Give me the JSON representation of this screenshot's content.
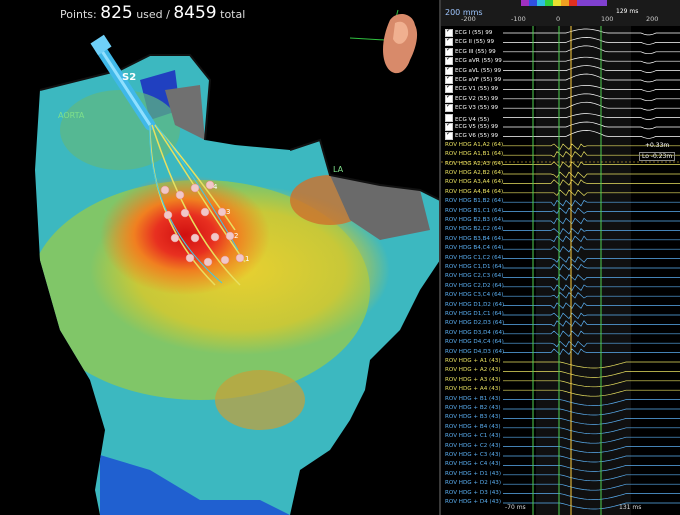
{
  "points": {
    "prefix": "Points:",
    "used": "825",
    "used_label": "used /",
    "total": "8459",
    "total_label": "total"
  },
  "labels": {
    "aorta": "AORTA",
    "la": "LA",
    "catheter": "S2"
  },
  "electrodes": [
    "4",
    "3",
    "2",
    "1",
    "4",
    "3",
    "2",
    "1"
  ],
  "ecg_panel": {
    "speed": "200 mms",
    "ticks": [
      "-200",
      "-100",
      "0",
      "100",
      "200"
    ],
    "measure_top": "129 ms",
    "measure_left": "-70 ms",
    "measure_right": "131 ms",
    "cursor_a": "+0.33m",
    "cursor_b": "Lo -0.23m"
  },
  "leads": [
    {
      "label": "ECG I (55) 99",
      "color": "#ffffff",
      "checked": true
    },
    {
      "label": "ECG II (55) 99",
      "color": "#ffffff",
      "checked": true
    },
    {
      "label": "ECG III (55) 99",
      "color": "#ffffff",
      "checked": true
    },
    {
      "label": "ECG aVR (55) 99",
      "color": "#ffffff",
      "checked": true
    },
    {
      "label": "ECG aVL (55) 99",
      "color": "#ffffff",
      "checked": true
    },
    {
      "label": "ECG aVF (55) 99",
      "color": "#ffffff",
      "checked": true
    },
    {
      "label": "ECG V1 (55) 99",
      "color": "#ffffff",
      "checked": true
    },
    {
      "label": "ECG V2 (55) 99",
      "color": "#ffffff",
      "checked": true
    },
    {
      "label": "ECG V3 (55) 99",
      "color": "#ffffff",
      "checked": true
    },
    {
      "label": "ECG V4 (55)",
      "color": "#ffffff",
      "checked": false
    },
    {
      "label": "ECG V5 (55) 99",
      "color": "#ffffff",
      "checked": true
    },
    {
      "label": "ECG V6 (55) 99",
      "color": "#ffffff",
      "checked": true
    },
    {
      "label": "ROV HDG A1,A2 (64)",
      "color": "#e8e060",
      "checked": false
    },
    {
      "label": "ROV HDG A1,B1 (64)",
      "color": "#e8e060",
      "checked": false
    },
    {
      "label": "ROV HDG A2,A3 (64)",
      "color": "#e8e060",
      "checked": false
    },
    {
      "label": "ROV HDG A2,B2 (64)",
      "color": "#e8e060",
      "checked": false
    },
    {
      "label": "ROV HDG A3,A4 (64)",
      "color": "#e8e060",
      "checked": false
    },
    {
      "label": "ROV HDG A4,B4 (64)",
      "color": "#e8e060",
      "checked": false
    },
    {
      "label": "ROV HDG B1,B2 (64)",
      "color": "#5aaef0",
      "checked": false
    },
    {
      "label": "ROV HDG B1,C1 (64)",
      "color": "#5aaef0",
      "checked": false
    },
    {
      "label": "ROV HDG B2,B3 (64)",
      "color": "#5aaef0",
      "checked": false
    },
    {
      "label": "ROV HDG B2,C2 (64)",
      "color": "#5aaef0",
      "checked": false
    },
    {
      "label": "ROV HDG B3,B4 (64)",
      "color": "#5aaef0",
      "checked": false
    },
    {
      "label": "ROV HDG B4,C4 (64)",
      "color": "#5aaef0",
      "checked": false
    },
    {
      "label": "ROV HDG C1,C2 (64)",
      "color": "#5aaef0",
      "checked": false
    },
    {
      "label": "ROV HDG C1,D1 (64)",
      "color": "#5aaef0",
      "checked": false
    },
    {
      "label": "ROV HDG C2,C3 (64)",
      "color": "#5aaef0",
      "checked": false
    },
    {
      "label": "ROV HDG C2,D2 (64)",
      "color": "#5aaef0",
      "checked": false
    },
    {
      "label": "ROV HDG C3,C4 (64)",
      "color": "#5aaef0",
      "checked": false
    },
    {
      "label": "ROV HDG D1,D2 (64)",
      "color": "#5aaef0",
      "checked": false
    },
    {
      "label": "ROV HDG D1,C1 (64)",
      "color": "#5aaef0",
      "checked": false
    },
    {
      "label": "ROV HDG D2,D3 (64)",
      "color": "#5aaef0",
      "checked": false
    },
    {
      "label": "ROV HDG D3,D4 (64)",
      "color": "#5aaef0",
      "checked": false
    },
    {
      "label": "ROV HDG D4,C4 (64)",
      "color": "#5aaef0",
      "checked": false
    },
    {
      "label": "ROV HDG D4,D3 (64)",
      "color": "#5aaef0",
      "checked": false
    },
    {
      "label": "ROV HDG + A1 (43)",
      "color": "#e8e060",
      "checked": false
    },
    {
      "label": "ROV HDG + A2 (43)",
      "color": "#e8e060",
      "checked": false
    },
    {
      "label": "ROV HDG + A3 (43)",
      "color": "#e8e060",
      "checked": false
    },
    {
      "label": "ROV HDG + A4 (43)",
      "color": "#e8e060",
      "checked": false
    },
    {
      "label": "ROV HDG + B1 (43)",
      "color": "#5aaef0",
      "checked": false
    },
    {
      "label": "ROV HDG + B2 (43)",
      "color": "#5aaef0",
      "checked": false
    },
    {
      "label": "ROV HDG + B3 (43)",
      "color": "#5aaef0",
      "checked": false
    },
    {
      "label": "ROV HDG + B4 (43)",
      "color": "#5aaef0",
      "checked": false
    },
    {
      "label": "ROV HDG + C1 (43)",
      "color": "#5aaef0",
      "checked": false
    },
    {
      "label": "ROV HDG + C2 (43)",
      "color": "#5aaef0",
      "checked": false
    },
    {
      "label": "ROV HDG + C3 (43)",
      "color": "#5aaef0",
      "checked": false
    },
    {
      "label": "ROV HDG + C4 (43)",
      "color": "#5aaef0",
      "checked": false
    },
    {
      "label": "ROV HDG + D1 (43)",
      "color": "#5aaef0",
      "checked": false
    },
    {
      "label": "ROV HDG + D2 (43)",
      "color": "#5aaef0",
      "checked": false
    },
    {
      "label": "ROV HDG + D3 (43)",
      "color": "#5aaef0",
      "checked": false
    },
    {
      "label": "ROV HDG + D4 (43)",
      "color": "#5aaef0",
      "checked": false
    }
  ]
}
